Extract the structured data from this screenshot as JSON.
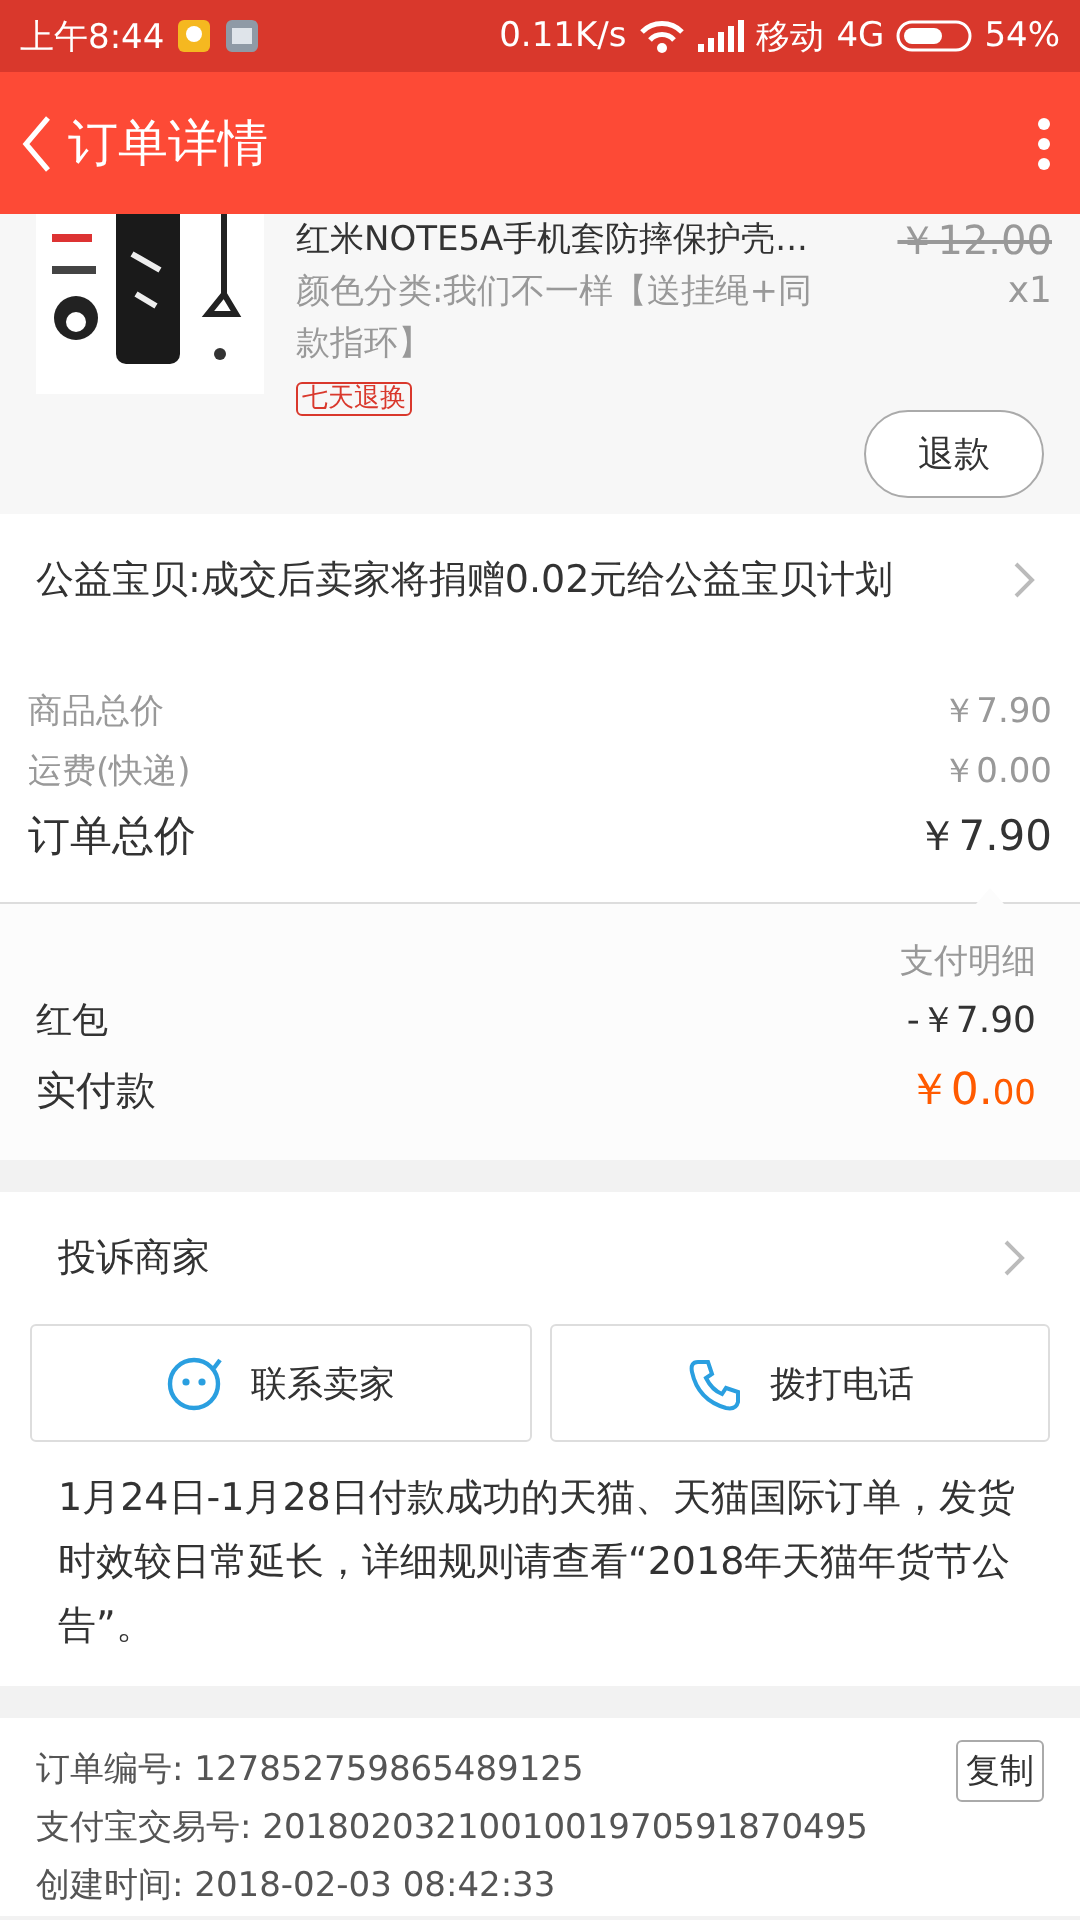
{
  "status_bar": {
    "time": "上午8:44",
    "speed": "0.11K/s",
    "carrier": "移动",
    "network": "4G",
    "battery": "54%"
  },
  "header": {
    "title": "订单详情"
  },
  "product": {
    "title": "红米NOTE5A手机套防摔保护壳...",
    "variant": "颜色分类:我们不一样【送挂绳+同款指环】",
    "tag": "七天退换",
    "original_price": "￥12.00",
    "quantity": "x1",
    "action": "退款"
  },
  "charity": {
    "text": "公益宝贝:成交后卖家将捐赠0.02元给公益宝贝计划"
  },
  "price_rows": [
    {
      "label": "商品总价",
      "value": "￥7.90",
      "kind": "minor"
    },
    {
      "label": "运费(快递)",
      "value": "￥0.00",
      "kind": "minor"
    },
    {
      "label": "订单总价",
      "value": "￥7.90",
      "kind": "total"
    }
  ],
  "payment": {
    "heading": "支付明细",
    "rows": [
      {
        "label": "红包",
        "value": "-￥7.90"
      }
    ],
    "paid_label": "实付款",
    "paid_main": "￥0.",
    "paid_cents": "00"
  },
  "complaint": {
    "label": "投诉商家"
  },
  "contact_buttons": [
    {
      "label": "联系卖家",
      "kind": "chat"
    },
    {
      "label": "拨打电话",
      "kind": "phone"
    }
  ],
  "notice": "1月24日-1月28日付款成功的天猫、天猫国际订单，发货时效较日常延长，详细规则请查看“2018年天猫年货节公告”。",
  "order_info": {
    "copy_button": "复制",
    "rows": [
      "订单编号: 127852759865489125",
      "支付宝交易号: 2018020321001001970591870495",
      "创建时间: 2018-02-03 08:42:33"
    ]
  }
}
